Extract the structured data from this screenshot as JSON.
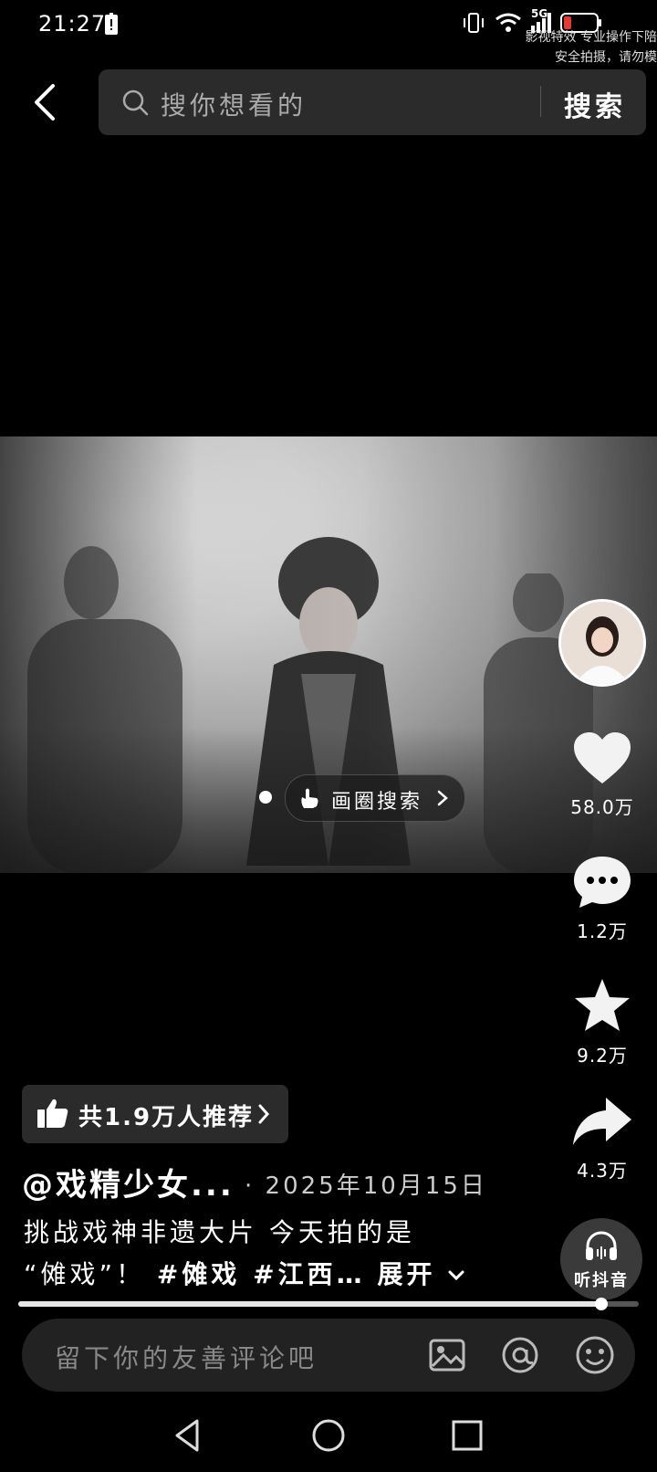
{
  "status_bar": {
    "time": "21:27",
    "network": "5G",
    "watermark_line1": "影视特效 专业操作下陪",
    "watermark_line2": "安全拍摄，请勿模"
  },
  "top": {
    "search_placeholder": "搜你想看的",
    "search_button": "搜索"
  },
  "video": {
    "circle_search_label": "画圈搜索"
  },
  "rail": {
    "likes": "58.0万",
    "comments": "1.2万",
    "favorites": "9.2万",
    "shares": "4.3万",
    "listen_label": "听抖音"
  },
  "info": {
    "recommend": "共1.9万人推荐",
    "author": "@戏精少女...",
    "date": "· 2025年10月15日",
    "desc_line1": "挑战戏神非遗大片 今天拍的是",
    "desc_line2_plain": "“傩戏”！",
    "desc_line2_tags": "#傩戏 #江西…",
    "expand": "展开"
  },
  "progress": {
    "fraction": 0.94
  },
  "comment": {
    "placeholder": "留下你的友善评论吧"
  },
  "colors": {
    "background": "#000000",
    "panel": "#2b2b2b",
    "accent": "#ffffff"
  }
}
